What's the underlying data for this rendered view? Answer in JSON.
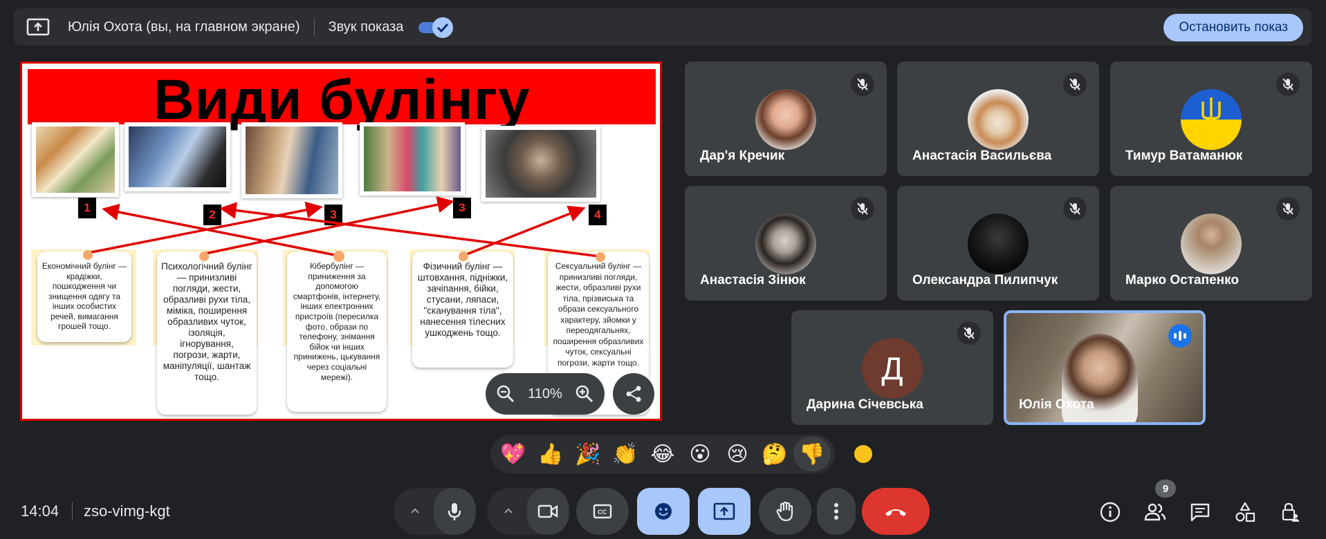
{
  "presenting_bar": {
    "presenter": "Юлія Охота (вы, на главном экране)",
    "sound_label": "Звук показа",
    "sound_enabled": true,
    "stop_button": "Остановить показ"
  },
  "slide": {
    "title": "Види булінгу",
    "numbers": [
      "1",
      "2",
      "3",
      "3",
      "4"
    ],
    "cards": [
      "Економічний булінг — крадіжки, пошкодження чи знищення одягу та інших особистих речей, вимагання грошей тощо.",
      "Психологічний булінг — принизливі погляди, жести, образливі рухи тіла, міміка, поширення образливих чуток, ізоляція, ігнорування, погрози, жарти, маніпуляції, шантаж тощо.",
      "Кібербулінг — приниження за допомогою смартфонів, інтернету, інших електронних пристроїв (пересилка фото, образи по телефону, знімання бійок чи інших принижень, цькування через соціальні мережі).",
      "Фізичний булінг — штовхання, підніжки, зачіпання, бійки, стусани, ляпаси, \"сканування тіла\", нанесення тілесних ушкоджень тощо.",
      "Сексуальний булінг — принизливі погляди, жести, образливі рухи тіла, прізвиська та образи сексуального характеру, зйомки у переодягальнях, поширення образливих чуток, сексуальні погрози, жарти тощо."
    ]
  },
  "zoom": {
    "level": "110%"
  },
  "participants": [
    {
      "name": "Дар'я Кречик",
      "muted": true
    },
    {
      "name": "Анастасія Васильєва",
      "muted": true
    },
    {
      "name": "Тимур Ватаманюк",
      "muted": true
    },
    {
      "name": "Анастасія Зінюк",
      "muted": true
    },
    {
      "name": "Олександра Пилипчук",
      "muted": true
    },
    {
      "name": "Марко Остапенко",
      "muted": true
    },
    {
      "name": "Дарина Січевська",
      "initial": "Д",
      "muted": true
    },
    {
      "name": "Юлія Охота",
      "speaking": true
    }
  ],
  "reactions": [
    "💖",
    "👍",
    "🎉",
    "👏",
    "😂",
    "😮",
    "😢",
    "🤔",
    "👎"
  ],
  "bottom_bar": {
    "time": "14:04",
    "meeting_code": "zso-vimg-kgt",
    "people_count": "9"
  },
  "colors": {
    "background": "#202124",
    "tile": "#3c4043",
    "accent": "#a8c7fa",
    "end_call": "#dc362e",
    "slide_red": "#ff0000"
  }
}
